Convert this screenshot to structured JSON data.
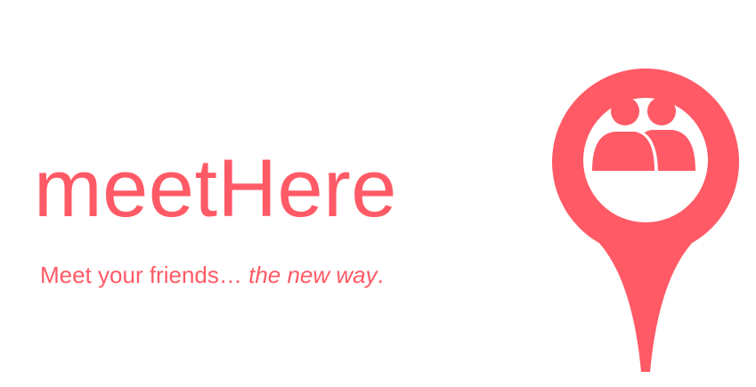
{
  "brand": {
    "name": "meetHere",
    "tagline_prefix": "Meet your friends… ",
    "tagline_emphasis": "the new way",
    "tagline_suffix": "."
  },
  "colors": {
    "brand": "#FF5A66",
    "background": "#FFFFFF"
  },
  "logo": {
    "icon": "map-pin-with-people-icon"
  }
}
